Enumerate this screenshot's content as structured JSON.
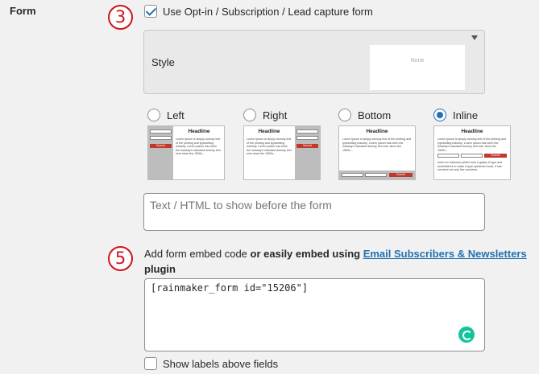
{
  "form": {
    "label": "Form",
    "step_three": "3",
    "step_five": "5",
    "optin_label": "Use Opt-in / Subscription / Lead capture form",
    "optin_checked": true,
    "style": {
      "label": "Style",
      "preview_text": "None"
    },
    "positions": [
      {
        "label": "Left",
        "selected": false
      },
      {
        "label": "Right",
        "selected": false
      },
      {
        "label": "Bottom",
        "selected": false
      },
      {
        "label": "Inline",
        "selected": true
      }
    ],
    "thumb_headline": "Headline",
    "thumb_text": "Lorem Ipsum is simply dummy text of the printing and typesetting industry. Lorem Ipsum has been the industry's standard dummy text ever since the 1500s...",
    "thumb_text_extra": "when an unknown printer took a galley of type and scrambled it to make a type specimen book, it has survived not only five centuries.",
    "thumb_submit": "Submit",
    "text_html_placeholder": "Text / HTML to show before the form",
    "embed_prefix": "Add form embed code ",
    "embed_bold": "or easily embed using ",
    "embed_link": "Email Subscribers & Newsletters",
    "embed_suffix": " plugin",
    "embed_code": "[rainmaker_form id=\"15206\"]",
    "show_labels": "Show labels above fields",
    "show_labels_checked": false
  },
  "colors": {
    "accent": "#2271b1",
    "badge": "#d0131b",
    "submit": "#c0392b",
    "grammarly": "#15c39a"
  },
  "icons": {
    "grammarly": "grammarly-icon",
    "dropdown": "chevron-down-icon"
  }
}
